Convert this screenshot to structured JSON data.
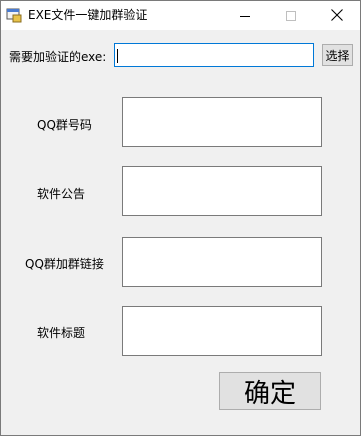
{
  "window": {
    "title": "EXE文件一键加群验证"
  },
  "form": {
    "exe_label": "需要加验证的exe:",
    "exe_value": "",
    "browse_label": "选择",
    "qq_group_label": "QQ群号码",
    "qq_group_value": "",
    "notice_label": "软件公告",
    "notice_value": "",
    "join_link_label": "QQ群加群链接",
    "join_link_value": "",
    "software_title_label": "软件标题",
    "software_title_value": "",
    "confirm_label": "确定"
  },
  "icons": {
    "app": "app-icon",
    "minimize": "minimize-icon",
    "maximize": "maximize-icon",
    "close": "close-icon"
  }
}
